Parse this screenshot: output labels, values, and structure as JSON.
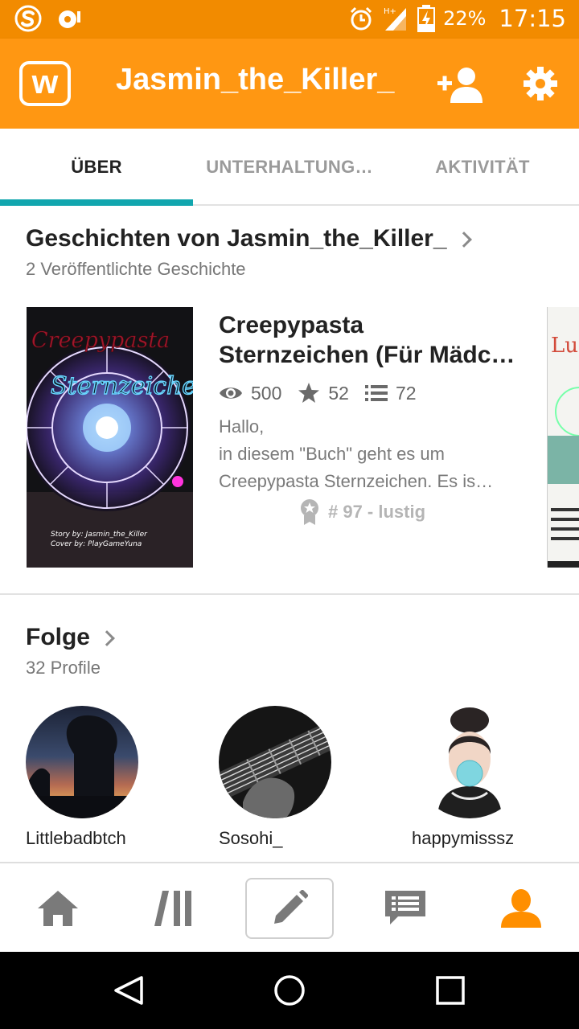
{
  "status_bar": {
    "battery": "22%",
    "time": "17:15",
    "network_type": "H+",
    "icons": [
      "s-app-icon",
      "headset-icon",
      "alarm-icon",
      "signal-icon",
      "battery-charging-icon"
    ]
  },
  "app_bar": {
    "logo_letter": "w",
    "title": "Jasmin_the_Killer_",
    "actions": [
      "add-follow-icon",
      "settings-gear-icon"
    ]
  },
  "tabs": [
    {
      "label": "ÜBER",
      "active": true
    },
    {
      "label": "UNTERHALTUNG…",
      "active": false
    },
    {
      "label": "AKTIVITÄT",
      "active": false
    }
  ],
  "stories": {
    "heading": "Geschichten von Jasmin_the_Killer_",
    "count_text": "2 Veröffentlichte Geschichte",
    "story": {
      "title_line1": "Creepypasta",
      "title_line2": "Sternzeichen (Für Mädc…",
      "reads": "500",
      "votes": "52",
      "parts": "72",
      "desc_line1": "Hallo,",
      "desc_line2": "in diesem \"Buch\" geht es um",
      "desc_line3": "Creepypasta Sternzeichen. Es is…",
      "rank": "# 97 - lustig",
      "cover": {
        "title_top": "Creepypasta",
        "title_bottom": "Sternzeichen",
        "credit1": "Story by: Jasmin_the_Killer",
        "credit2": "Cover by: PlayGameYuna"
      }
    },
    "next_cover_letters": "Lu Se"
  },
  "following": {
    "heading": "Folge",
    "count_text": "32 Profile",
    "profiles": [
      {
        "name": "Littlebadbtch"
      },
      {
        "name": "Sosohi_"
      },
      {
        "name": "happymisssz"
      }
    ]
  },
  "bottom_nav": {
    "items": [
      "home-icon",
      "library-icon",
      "write-pencil-icon",
      "messages-icon",
      "profile-icon"
    ],
    "active_index": 4
  },
  "colors": {
    "status_bar": "#f28b00",
    "app_bar": "#ff9712",
    "tab_indicator": "#11a6ae",
    "active_nav": "#ff8f00",
    "inactive_nav": "#777777"
  }
}
